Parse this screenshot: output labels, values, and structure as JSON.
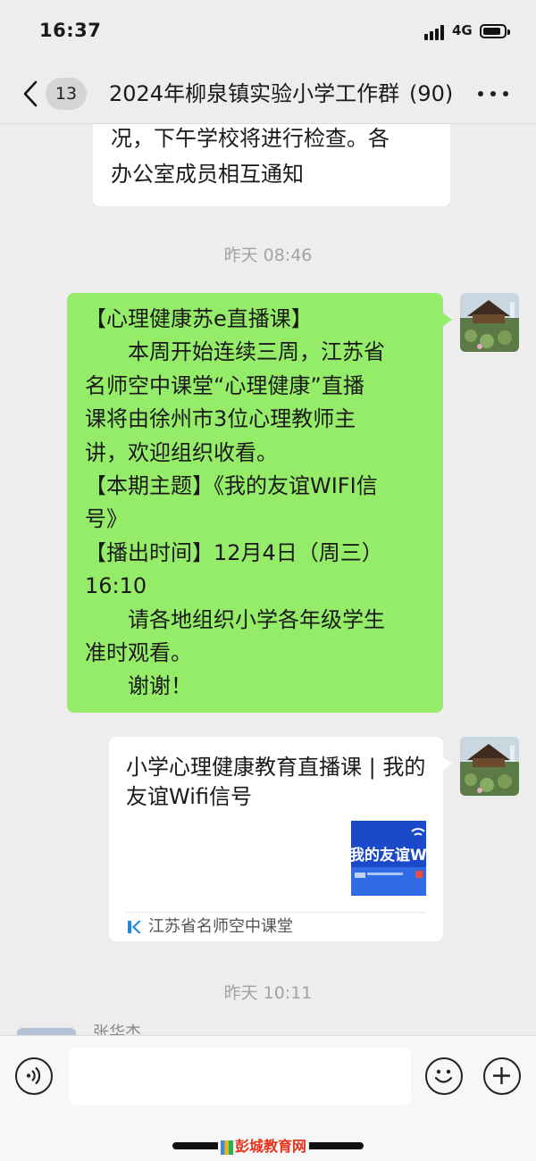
{
  "status_bar": {
    "time": "16:37",
    "network": "4G"
  },
  "nav": {
    "unread_badge": "13",
    "title": "2024年柳泉镇实验小学工作群",
    "member_count": "(90)"
  },
  "chat": {
    "prev_message_lines": [
      "况，下午学校将进行检查。各",
      "办公室成员相互通知"
    ],
    "timestamp_1": "昨天 08:46",
    "notice_lines": [
      "【心理健康苏e直播课】",
      "　　本周开始连续三周，江苏省",
      "名师空中课堂“心理健康”直播",
      "课将由徐州市3位心理教师主",
      "讲，欢迎组织收看。",
      "【本期主题】《我的友谊WIFI信",
      "号》",
      "【播出时间】12月4日（周三）",
      "16:10",
      "　　请各地组织小学各年级学生",
      "准时观看。",
      "　　谢谢！"
    ],
    "link_card": {
      "title": "小学心理健康教育直播课 | 我的友谊Wifi信号",
      "thumb_text": "我的友谊Wifi",
      "source": "江苏省名师空中课堂"
    },
    "timestamp_2": "昨天 10:11",
    "next_sender": "张华杰"
  },
  "watermark": "彭城教育网"
}
